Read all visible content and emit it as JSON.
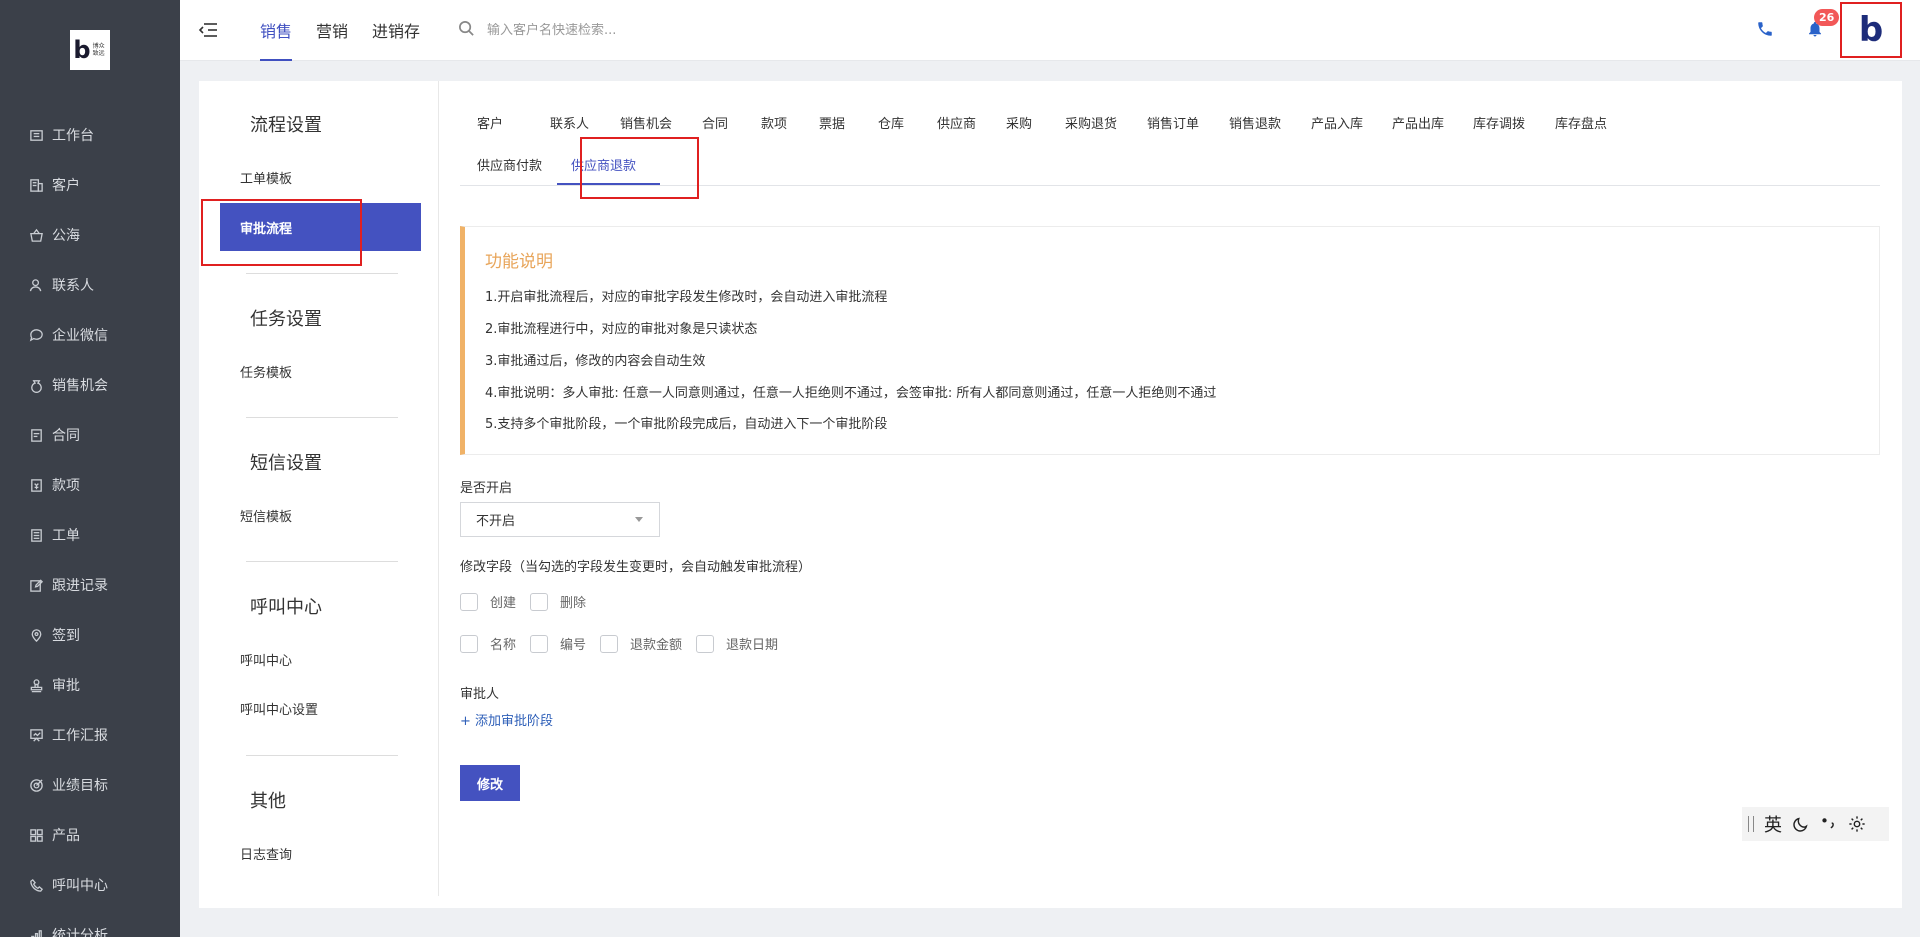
{
  "brand": {
    "logo_mark": "b",
    "logo_text": "博众致远"
  },
  "sidebar": {
    "items": [
      {
        "label": "工作台",
        "icon": "dashboard-icon"
      },
      {
        "label": "客户",
        "icon": "building-icon"
      },
      {
        "label": "公海",
        "icon": "basket-icon"
      },
      {
        "label": "联系人",
        "icon": "person-icon"
      },
      {
        "label": "企业微信",
        "icon": "chat-icon"
      },
      {
        "label": "销售机会",
        "icon": "moneybag-icon"
      },
      {
        "label": "合同",
        "icon": "contract-icon"
      },
      {
        "label": "款项",
        "icon": "payment-icon"
      },
      {
        "label": "工单",
        "icon": "ticket-icon"
      },
      {
        "label": "跟进记录",
        "icon": "edit-icon"
      },
      {
        "label": "签到",
        "icon": "location-icon"
      },
      {
        "label": "审批",
        "icon": "stamp-icon"
      },
      {
        "label": "工作汇报",
        "icon": "report-icon"
      },
      {
        "label": "业绩目标",
        "icon": "target-icon"
      },
      {
        "label": "产品",
        "icon": "grid-icon"
      },
      {
        "label": "呼叫中心",
        "icon": "phone-icon"
      },
      {
        "label": "统计分析",
        "icon": "chart-icon"
      }
    ]
  },
  "header": {
    "tabs": [
      "销售",
      "营销",
      "进销存"
    ],
    "active_tab": 0,
    "search_placeholder": "输入客户名快速检索...",
    "notification_count": "26",
    "avatar_mark": "b"
  },
  "settings_menu": {
    "sections": [
      {
        "title": "流程设置",
        "items": [
          "工单模板",
          "审批流程"
        ]
      },
      {
        "title": "任务设置",
        "items": [
          "任务模板"
        ]
      },
      {
        "title": "短信设置",
        "items": [
          "短信模板"
        ]
      },
      {
        "title": "呼叫中心",
        "items": [
          "呼叫中心",
          "呼叫中心设置"
        ]
      },
      {
        "title": "其他",
        "items": [
          "日志查询"
        ]
      }
    ],
    "active_item": "审批流程"
  },
  "module_tabs": {
    "row1": [
      "客户",
      "联系人",
      "销售机会",
      "合同",
      "款项",
      "票据",
      "仓库",
      "供应商",
      "采购",
      "采购退货",
      "销售订单",
      "销售退款",
      "产品入库",
      "产品出库",
      "库存调拨",
      "库存盘点"
    ],
    "row2": [
      "供应商付款",
      "供应商退款"
    ],
    "active": "供应商退款"
  },
  "info": {
    "title": "功能说明",
    "lines": [
      "1.开启审批流程后，对应的审批字段发生修改时，会自动进入审批流程",
      "2.审批流程进行中，对应的审批对象是只读状态",
      "3.审批通过后，修改的内容会自动生效",
      "4.审批说明：多人审批: 任意一人同意则通过，任意一人拒绝则不通过，会签审批: 所有人都同意则通过，任意一人拒绝则不通过",
      "5.支持多个审批阶段，一个审批阶段完成后，自动进入下一个审批阶段"
    ]
  },
  "form": {
    "enable_label": "是否开启",
    "enable_value": "不开启",
    "fields_label": "修改字段（当勾选的字段发生变更时，会自动触发审批流程）",
    "fields_row1": [
      "创建",
      "删除"
    ],
    "fields_row2": [
      "名称",
      "编号",
      "退款金额",
      "退款日期"
    ],
    "approver_label": "审批人",
    "add_stage": "+ 添加审批阶段",
    "save_label": "修改"
  },
  "ime": {
    "lang": "英"
  }
}
